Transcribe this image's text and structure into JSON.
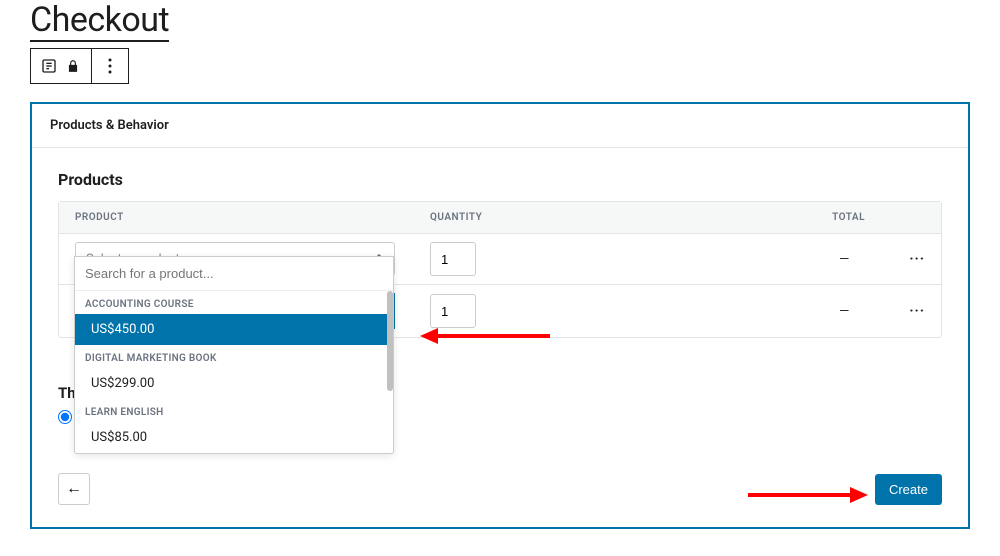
{
  "pageTitle": "Checkout",
  "panel": {
    "header": "Products & Behavior",
    "productsTitle": "Products",
    "columns": {
      "product": "PRODUCT",
      "quantity": "QUANTITY",
      "total": "TOTAL"
    },
    "rows": [
      {
        "placeholder": "Select a product",
        "qty": "1",
        "total": "—"
      },
      {
        "placeholder": "Search for a product...",
        "qty": "1",
        "total": "—"
      }
    ],
    "dropdown": {
      "searchPlaceholder": "Search for a product...",
      "groups": [
        {
          "label": "ACCOUNTING COURSE",
          "items": [
            {
              "text": "US$450.00",
              "selected": true
            }
          ]
        },
        {
          "label": "DIGITAL MARKETING BOOK",
          "items": [
            {
              "text": "US$299.00",
              "selected": false
            }
          ]
        },
        {
          "label": "LEARN ENGLISH",
          "items": [
            {
              "text": "US$85.00",
              "selected": false
            }
          ]
        }
      ]
    },
    "thSection": "Th",
    "createLabel": "Create"
  }
}
